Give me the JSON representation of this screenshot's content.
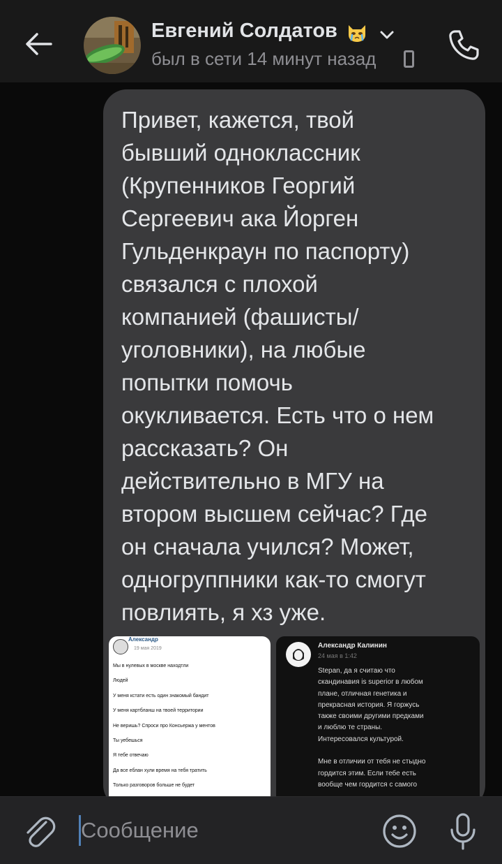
{
  "header": {
    "contact_name": "Евгений Солдатов",
    "status": "был в сети 14 минут назад"
  },
  "message": {
    "text": "Привет, кажется, твой\nбывший одноклассник\n(Крупенников Георгий\nСергеевич ака Йорген\nГульденкраун по паспорту)\nсвязался с плохой\nкомпанией (фашисты/\nуголовники), на любые\nпопытки помочь\nокукливается. Есть что о нем\nрассказать? Он\nдействительно в МГУ на\nвтором высшем сейчас? Где\nон сначала учился? Может,\nодногруппники как-то смогут\nповлиять, я хз уже."
  },
  "attachments": {
    "left": {
      "author": "Александр",
      "date": "19 мая 2019",
      "lines": [
        "Мы в нулевых в москве находтли",
        "Людей",
        "У меня кстати есть один знакомый бандит",
        "У меня картбланш на твоей территории",
        "Не веришь? Спроси про Консьержа у ментов",
        "Ты уебешься",
        "Я тебе отвечаю",
        "Да все еблан хули время на тебя тратить",
        "Только разговоров больше не будет"
      ]
    },
    "right": {
      "author": "Александр Калинин",
      "date": "24 мая в 1:42",
      "text": "Stepan, да я считаю что\nскандинавия is superior в любом\nплане, отличная генетика и\nпрекрасная история. Я горжусь\nтакже своими другими предками\nи люблю те страны.\nИнтересовался культурой.\n\nМне в отличии от тебя не стыдно\nгордится этим. Если тебе есть\nвообще чем гордится с самого"
    }
  },
  "composer": {
    "placeholder": "Сообщение"
  },
  "colors": {
    "background": "#0a0a0a",
    "header": "#191919",
    "bubble": "#3a3a3c",
    "composer": "#232325",
    "accent": "#5181b8"
  },
  "icons": [
    "back-arrow-icon",
    "crying-cat-emoji-icon",
    "chevron-down-icon",
    "mobile-phone-icon",
    "phone-call-icon",
    "paperclip-icon",
    "smile-icon",
    "microphone-icon"
  ]
}
